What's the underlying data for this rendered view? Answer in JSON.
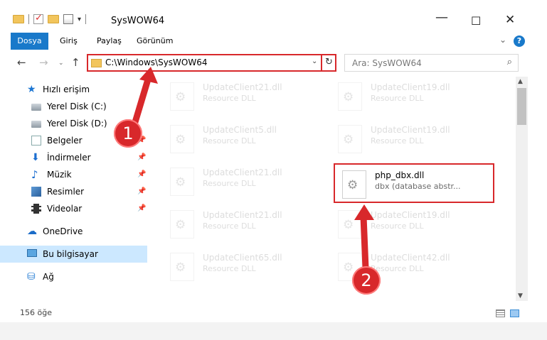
{
  "window": {
    "title": "SysWOW64",
    "minimize_glyph": "—",
    "maximize_glyph": "☐",
    "close_glyph": "✕"
  },
  "ribbon": {
    "tabs": [
      "Dosya",
      "Giriş",
      "Paylaş",
      "Görünüm"
    ],
    "expand_glyph": "⌄",
    "help_glyph": "?"
  },
  "nav": {
    "back_glyph": "←",
    "forward_glyph": "→",
    "history_glyph": "⌄",
    "up_glyph": "↑",
    "address_path": "C:\\Windows\\SysWOW64",
    "address_dropdown_glyph": "⌄",
    "refresh_glyph": "↻",
    "search_placeholder": "Ara: SysWOW64",
    "search_glyph": "⌕"
  },
  "sidebar": {
    "items": [
      {
        "label": "Hızlı erişim",
        "icon": "star-icon",
        "pinned": false
      },
      {
        "label": "Yerel Disk (C:)",
        "icon": "disk-icon",
        "pinned": false
      },
      {
        "label": "Yerel Disk (D:)",
        "icon": "disk-icon",
        "pinned": false
      },
      {
        "label": "Belgeler",
        "icon": "documents-icon",
        "pinned": true
      },
      {
        "label": "İndirmeler",
        "icon": "download-icon",
        "pinned": true
      },
      {
        "label": "Müzik",
        "icon": "music-icon",
        "pinned": true
      },
      {
        "label": "Resimler",
        "icon": "pictures-icon",
        "pinned": true
      },
      {
        "label": "Videolar",
        "icon": "videos-icon",
        "pinned": true
      },
      {
        "label": "OneDrive",
        "icon": "onedrive-icon",
        "pinned": false
      },
      {
        "label": "Bu bilgisayar",
        "icon": "this-pc-icon",
        "pinned": false,
        "selected": true
      },
      {
        "label": "Ağ",
        "icon": "network-icon",
        "pinned": false
      }
    ],
    "pin_glyph": "📌"
  },
  "files": [
    {
      "name": "UpdateClient21.dll",
      "desc": "Resource DLL",
      "faded": true
    },
    {
      "name": "UpdateClient19.dll",
      "desc": "Resource DLL",
      "faded": true
    },
    {
      "name": "UpdateClient5.dll",
      "desc": "Resource DLL",
      "faded": true
    },
    {
      "name": "UpdateClient19.dll",
      "desc": "Resource DLL",
      "faded": true
    },
    {
      "name": "UpdateClient21.dll",
      "desc": "Resource DLL",
      "faded": true
    },
    {
      "name": "php_dbx.dll",
      "desc": "dbx (database abstr...",
      "faded": false,
      "highlighted": true
    },
    {
      "name": "UpdateClient21.dll",
      "desc": "Resource DLL",
      "faded": true
    },
    {
      "name": "UpdateClient19.dll",
      "desc": "Resource DLL",
      "faded": true
    },
    {
      "name": "UpdateClient65.dll",
      "desc": "Resource DLL",
      "faded": true
    },
    {
      "name": "UpdateClient42.dll",
      "desc": "Resource DLL",
      "faded": true
    }
  ],
  "status": {
    "item_count": "156 öğe"
  },
  "annotations": {
    "callout_1": "1",
    "callout_2": "2",
    "color": "#d8282b"
  },
  "colors": {
    "accent": "#1979ca",
    "selection": "#cce8ff",
    "annotation_red": "#d8282b"
  }
}
